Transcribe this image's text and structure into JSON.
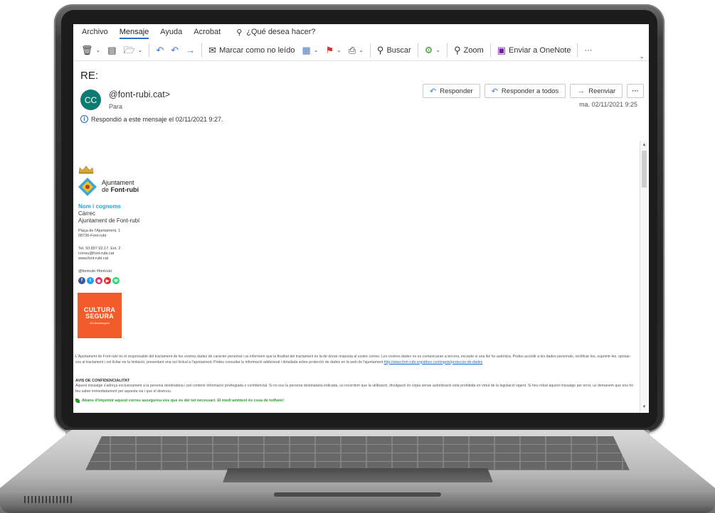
{
  "menu": {
    "items": [
      "Archivo",
      "Mensaje",
      "Ayuda",
      "Acrobat"
    ],
    "active": "Mensaje",
    "tell_me": "¿Qué desea hacer?"
  },
  "toolbar": {
    "mark_unread": "Marcar como no leído",
    "search": "Buscar",
    "zoom": "Zoom",
    "onenote": "Enviar a OneNote",
    "more": "···"
  },
  "message": {
    "subject": "RE:",
    "avatar_initials": "CC",
    "sender": "@font-rubi.cat>",
    "to_label": "Para",
    "replied_info": "Respondió a este mensaje el 02/11/2021 9:27.",
    "date": "ma. 02/11/2021 9:25"
  },
  "actions": {
    "reply": "Responder",
    "reply_all": "Responder a todos",
    "forward": "Reenviar",
    "more": "···"
  },
  "signature": {
    "org_line1": "Ajuntament",
    "org_line2_prefix": "de",
    "org_line2_bold": "Font-rubí",
    "name": "Nom i cognoms",
    "role": "Càrrec",
    "org": "Ajuntament de Font-rubí",
    "address1": "Plaça de l'Ajuntament, 1",
    "address2": "08736-Font-rubí",
    "phone": "Tel. 93.897.92.17. Ext. 2",
    "email": "correu@font-rubi.cat",
    "web": "www.font-rubi.cat",
    "hashtags": "@fontrubi #fontrubi",
    "badge_line1": "CULTURA",
    "badge_line2": "SEGURA",
    "badge_tag": "#Culturasegura"
  },
  "legal": {
    "text": "L'Ajuntament de Font-rubí és el responsable del tractament de les vostres dades de caràcter personal i us informem que la finalitat del tractament és la de donar resposta al vostre correu. Les vostres dades no es comunicaran a tercers, excepte si una llei ho autoritza. Podeu accedir a les dades personals, rectificar-les, suprimir-les, oposar-vos al tractament i sol·licitar-ne la limitació, presentant una sol·licitud a l'ajuntament. Podeu consultar la informació addicional i detallada sobre protecció de dades en la web de l'ajuntament",
    "link": "http://www.font-rubi.org/altres-continguts/proteccio-de-dades",
    "avis_title": "AVIS DE CONFIDENCIALITAT",
    "avis_text": "Aquest missatge s'adreça exclusivament a la persona destinatària i pot contenir informació privilegiada o confidencial. Si no sou la persona destinatària indicada, us recordem que la utilització, divulgació i/o còpia sense autorització està prohibida en virtut de la legislació vigent. Si heu rebut aquest missatge per error, us demanem que ens ho feu saber immediatament per aquesta via i que el destruïu.",
    "eco": "Abans d'imprimir aquest correu assegureu-vos que és del tot necessari. El medi ambient és cosa de tothom!"
  },
  "colors": {
    "accent": "#2b6cc4",
    "avatar": "#0e7a72",
    "sig_name": "#2aa3df",
    "badge": "#f25b2a",
    "eco": "#2d9a2d"
  }
}
